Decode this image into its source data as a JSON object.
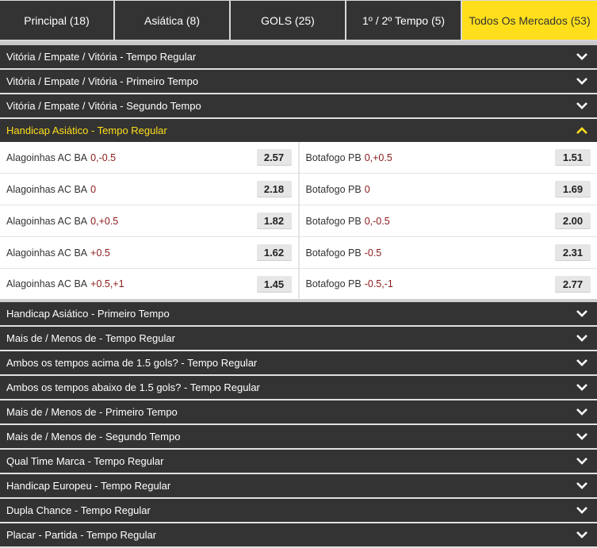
{
  "tabs": [
    {
      "label": "Principal (18)",
      "active": false
    },
    {
      "label": "Asiática (8)",
      "active": false
    },
    {
      "label": "GOLS (25)",
      "active": false
    },
    {
      "label": "1º / 2º Tempo (5)",
      "active": false
    },
    {
      "label": "Todos Os Mercados (53)",
      "active": true
    }
  ],
  "markets_top": [
    "Vitória / Empate / Vitória - Tempo Regular",
    "Vitória / Empate / Vitória - Primeiro Tempo",
    "Vitória / Empate / Vitória - Segundo Tempo"
  ],
  "open_market": {
    "title": "Handicap Asiático - Tempo Regular",
    "rows": [
      {
        "home": {
          "team": "Alagoinhas AC BA",
          "hcp": "0,-0.5",
          "price": "2.57"
        },
        "away": {
          "team": "Botafogo PB",
          "hcp": "0,+0.5",
          "price": "1.51"
        }
      },
      {
        "home": {
          "team": "Alagoinhas AC BA",
          "hcp": "0",
          "price": "2.18"
        },
        "away": {
          "team": "Botafogo PB",
          "hcp": "0",
          "price": "1.69"
        }
      },
      {
        "home": {
          "team": "Alagoinhas AC BA",
          "hcp": "0,+0.5",
          "price": "1.82"
        },
        "away": {
          "team": "Botafogo PB",
          "hcp": "0,-0.5",
          "price": "2.00"
        }
      },
      {
        "home": {
          "team": "Alagoinhas AC BA",
          "hcp": "+0.5",
          "price": "1.62"
        },
        "away": {
          "team": "Botafogo PB",
          "hcp": "-0.5",
          "price": "2.31"
        }
      },
      {
        "home": {
          "team": "Alagoinhas AC BA",
          "hcp": "+0.5,+1",
          "price": "1.45"
        },
        "away": {
          "team": "Botafogo PB",
          "hcp": "-0.5,-1",
          "price": "2.77"
        }
      }
    ]
  },
  "markets_bottom": [
    "Handicap Asiático - Primeiro Tempo",
    "Mais de / Menos de - Tempo Regular",
    "Ambos os tempos acima de 1.5 gols? - Tempo Regular",
    "Ambos os tempos abaixo de 1.5 gols? - Tempo Regular",
    "Mais de / Menos de - Primeiro Tempo",
    "Mais de / Menos de - Segundo Tempo",
    "Qual Time Marca - Tempo Regular",
    "Handicap Europeu - Tempo Regular",
    "Dupla Chance - Tempo Regular",
    "Placar - Partida - Tempo Regular"
  ],
  "colors": {
    "accent": "#ffdf1b",
    "header_bg": "#333333",
    "handicap_text": "#8a1a1a"
  }
}
